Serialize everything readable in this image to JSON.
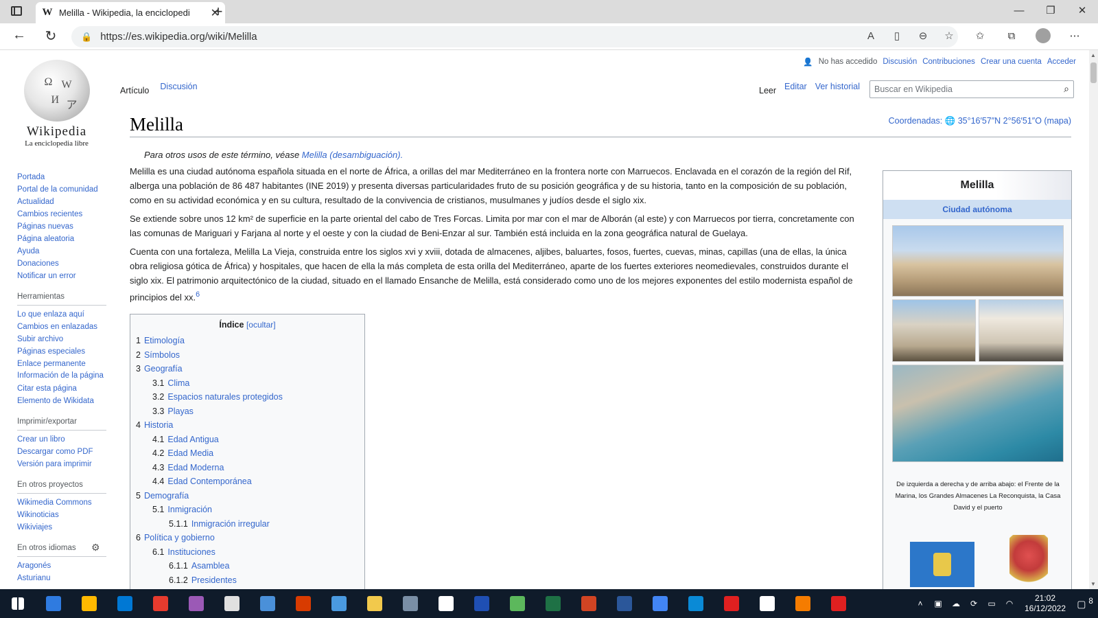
{
  "browser": {
    "tab_title": "Melilla - Wikipedia, la enciclopedi",
    "favicon": "W",
    "close_tab": "✕",
    "new_tab": "+",
    "url": "https://es.wikipedia.org/wiki/Melilla",
    "win_min": "—",
    "win_max": "❐",
    "win_close": "✕"
  },
  "logo": {
    "wordmark": "Wikipedia",
    "tagline": "La enciclopedia libre"
  },
  "sidebar": {
    "nav": [
      "Portada",
      "Portal de la comunidad",
      "Actualidad",
      "Cambios recientes",
      "Páginas nuevas",
      "Página aleatoria",
      "Ayuda",
      "Donaciones",
      "Notificar un error"
    ],
    "tools_heading": "Herramientas",
    "tools": [
      "Lo que enlaza aquí",
      "Cambios en enlazadas",
      "Subir archivo",
      "Páginas especiales",
      "Enlace permanente",
      "Información de la página",
      "Citar esta página",
      "Elemento de Wikidata"
    ],
    "print_heading": "Imprimir/exportar",
    "print": [
      "Crear un libro",
      "Descargar como PDF",
      "Versión para imprimir"
    ],
    "projects_heading": "En otros proyectos",
    "projects": [
      "Wikimedia Commons",
      "Wikinoticias",
      "Wikiviajes"
    ],
    "langs_heading": "En otros idiomas",
    "langs": [
      "Aragonés",
      "Asturianu"
    ]
  },
  "personal": {
    "not_logged": "No has accedido",
    "discussion": "Discusión",
    "contributions": "Contribuciones",
    "create_account": "Crear una cuenta",
    "login": "Acceder"
  },
  "tabs": {
    "article": "Artículo",
    "talk": "Discusión",
    "read": "Leer",
    "edit": "Editar",
    "history": "Ver historial"
  },
  "search": {
    "placeholder": "Buscar en Wikipedia"
  },
  "article": {
    "title": "Melilla",
    "coords": "Coordenadas: 🌐 35°16′57″N 2°56′51″O (mapa)",
    "dab_prefix": "Para otros usos de este término, véase ",
    "dab_link": "Melilla (desambiguación).",
    "p1": "Melilla es una ciudad autónoma española situada en el norte de África, a orillas del mar Mediterráneo en la frontera norte con Marruecos. Enclavada en el corazón de la región del Rif, alberga una población de 86 487 habitantes (INE 2019) y presenta diversas particularidades fruto de su posición geográfica y de su historia, tanto en la composición de su población, como en su actividad económica y en su cultura, resultado de la convivencia de cristianos, musulmanes y judíos desde el siglo xix.",
    "p2": "Se extiende sobre unos 12 km² de superficie en la parte oriental del cabo de Tres Forcas. Limita por mar con el mar de Alborán (al este) y con Marruecos por tierra, concretamente con las comunas de Mariguari y Farjana al norte y el oeste y con la ciudad de Beni-Enzar al sur. También está incluida en la zona geográfica natural de Guelaya.",
    "p3": "Cuenta con una fortaleza, Melilla La Vieja, construida entre los siglos xvi y xviii, dotada de almacenes, aljibes, baluartes, fosos, fuertes, cuevas, minas, capillas (una de ellas, la única obra religiosa gótica de África) y hospitales, que hacen de ella la más completa de esta orilla del Mediterráneo, aparte de los fuertes exteriores neomedievales, construidos durante el siglo xix. El patrimonio arquitectónico de la ciudad, situado en el llamado Ensanche de Melilla, está considerado como uno de los mejores exponentes del estilo modernista español de principios del xx.",
    "p3_ref": "6"
  },
  "toc": {
    "title": "Índice",
    "hide": "[ocultar]",
    "items": [
      {
        "num": "1",
        "text": "Etimología",
        "level": 1
      },
      {
        "num": "2",
        "text": "Símbolos",
        "level": 1
      },
      {
        "num": "3",
        "text": "Geografía",
        "level": 1
      },
      {
        "num": "3.1",
        "text": "Clima",
        "level": 2
      },
      {
        "num": "3.2",
        "text": "Espacios naturales protegidos",
        "level": 2
      },
      {
        "num": "3.3",
        "text": "Playas",
        "level": 2
      },
      {
        "num": "4",
        "text": "Historia",
        "level": 1
      },
      {
        "num": "4.1",
        "text": "Edad Antigua",
        "level": 2
      },
      {
        "num": "4.2",
        "text": "Edad Media",
        "level": 2
      },
      {
        "num": "4.3",
        "text": "Edad Moderna",
        "level": 2
      },
      {
        "num": "4.4",
        "text": "Edad Contemporánea",
        "level": 2
      },
      {
        "num": "5",
        "text": "Demografía",
        "level": 1
      },
      {
        "num": "5.1",
        "text": "Inmigración",
        "level": 2
      },
      {
        "num": "5.1.1",
        "text": "Inmigración irregular",
        "level": 3
      },
      {
        "num": "6",
        "text": "Política y gobierno",
        "level": 1
      },
      {
        "num": "6.1",
        "text": "Instituciones",
        "level": 2
      },
      {
        "num": "6.1.1",
        "text": "Asamblea",
        "level": 3
      },
      {
        "num": "6.1.2",
        "text": "Presidentes",
        "level": 3
      }
    ]
  },
  "infobox": {
    "title": "Melilla",
    "subtitle": "Ciudad autónoma",
    "caption": "De izquierda a derecha y de arriba abajo: el Frente de la Marina, los Grandes Almacenes La Reconquista, la Casa David y el puerto"
  },
  "taskbar": {
    "clock_time": "21:02",
    "clock_date": "16/12/2022",
    "notifications": "8",
    "icon_colors": [
      "#2f7be0",
      "#ffb900",
      "#0078d4",
      "#e63b2e",
      "#9b59b6",
      "#e0e0e0",
      "#4a90d9",
      "#d83b01",
      "#4a9ae0",
      "#f2c94c",
      "#7a8fa6",
      "#ffffff",
      "#1f4fb3",
      "#5cb85c",
      "#1e7145",
      "#d04423",
      "#2b579a",
      "#4285f4",
      "#0a8ad6",
      "#e02020",
      "#ffffff",
      "#f57c00",
      "#e02020"
    ]
  }
}
